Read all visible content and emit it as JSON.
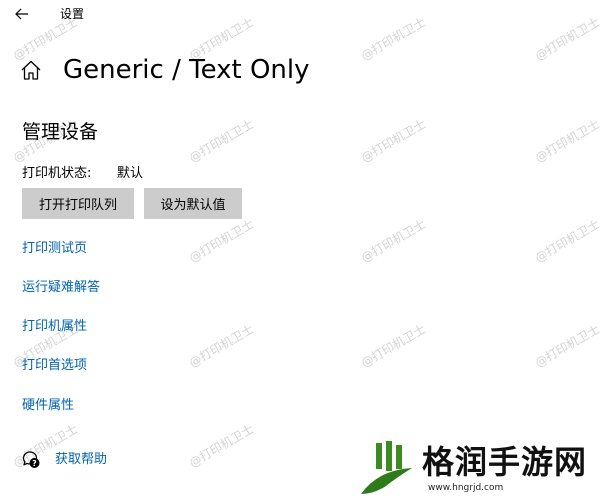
{
  "window": {
    "title": "设置",
    "back_icon": "arrow-left-icon"
  },
  "page": {
    "home_icon": "home-icon",
    "title": "Generic / Text Only"
  },
  "manage": {
    "heading": "管理设备",
    "status_label": "打印机状态:",
    "status_value": "默认",
    "buttons": {
      "open_queue": "打开打印队列",
      "set_default": "设为默认值"
    }
  },
  "links": [
    "打印测试页",
    "运行疑难解答",
    "打印机属性",
    "打印首选项",
    "硬件属性"
  ],
  "help": {
    "icon": "chat-help-icon",
    "label": "获取帮助"
  },
  "watermark": {
    "text": "@打印机卫士"
  },
  "logo": {
    "text": "格润手游网",
    "url": "www.hngrjd.com"
  },
  "colors": {
    "link": "#0063b1",
    "button_bg": "#cccccc",
    "logo_green": "#3c8a22"
  }
}
